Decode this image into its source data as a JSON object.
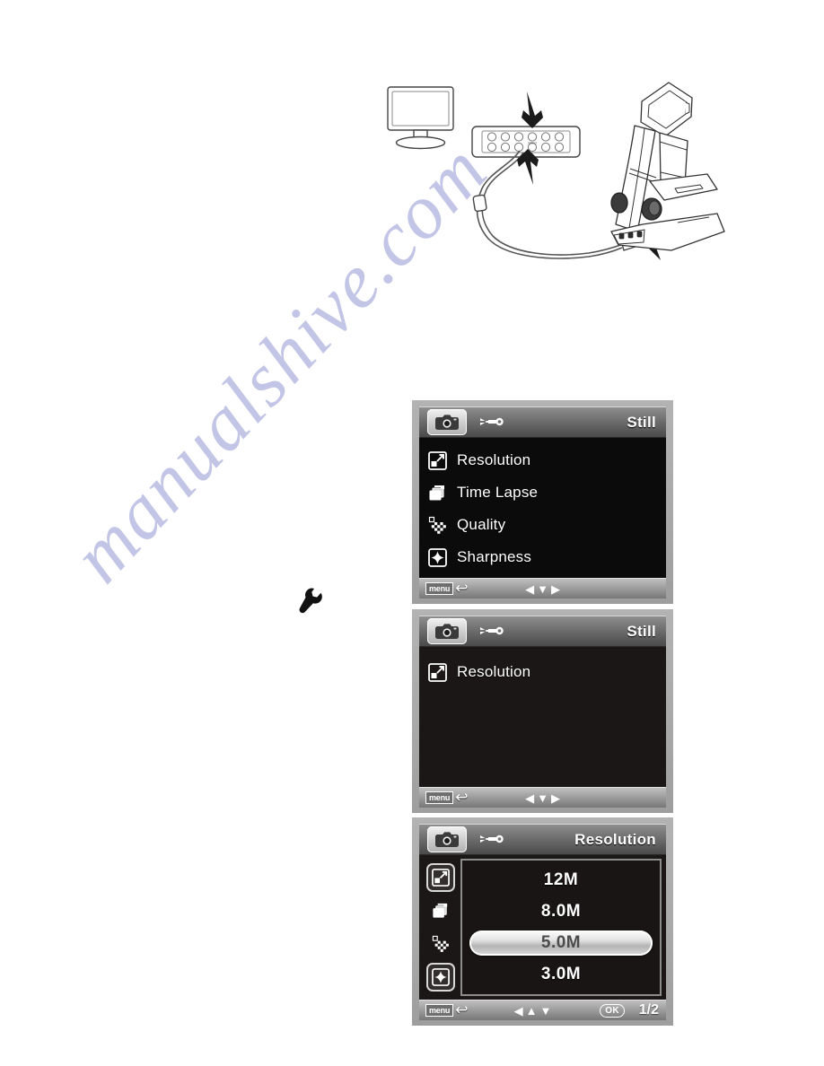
{
  "watermark": {
    "text": "manualshive.com"
  },
  "diagram": {
    "name": "tv-connection-diagram",
    "parts": [
      {
        "name": "monitor",
        "label": ""
      },
      {
        "name": "av-input-panel",
        "label": ""
      },
      {
        "name": "av-cable",
        "label": ""
      },
      {
        "name": "digital-microscope",
        "label": ""
      },
      {
        "name": "arrow-to-tv-port",
        "label": ""
      },
      {
        "name": "arrow-to-cable-plug",
        "label": ""
      },
      {
        "name": "arrow-to-microscope-port",
        "label": ""
      }
    ]
  },
  "body_wrench": {
    "icon": "wrench-icon"
  },
  "panels": [
    {
      "id": "osd-still-menu",
      "header": {
        "camera_tab": "camera-icon",
        "setup_tab": "wrench-icon",
        "mode_label": "Still"
      },
      "menu_items": [
        {
          "icon": "resolution-icon",
          "label": "Resolution"
        },
        {
          "icon": "time-lapse-icon",
          "label": "Time Lapse"
        },
        {
          "icon": "quality-icon",
          "label": "Quality"
        },
        {
          "icon": "sharpness-icon",
          "label": "Sharpness"
        }
      ],
      "footer": {
        "menu_label": "menu",
        "back_arrow": "↩",
        "dpad": [
          "◀",
          "▼",
          "▶"
        ],
        "ok_label": "",
        "page_label": ""
      }
    },
    {
      "id": "osd-still-resolution-only",
      "header": {
        "camera_tab": "camera-icon",
        "setup_tab": "wrench-icon",
        "mode_label": "Still"
      },
      "menu_items": [
        {
          "icon": "resolution-icon",
          "label": "Resolution"
        }
      ],
      "footer": {
        "menu_label": "menu",
        "back_arrow": "↩",
        "dpad": [
          "◀",
          "▼",
          "▶"
        ],
        "ok_label": "",
        "page_label": ""
      }
    },
    {
      "id": "osd-resolution-options",
      "header": {
        "camera_tab": "camera-icon",
        "setup_tab": "wrench-icon",
        "mode_label": "Resolution"
      },
      "side_rail": [
        {
          "icon": "resolution-icon",
          "selected": true
        },
        {
          "icon": "time-lapse-icon",
          "selected": false
        },
        {
          "icon": "quality-icon",
          "selected": false
        },
        {
          "icon": "sharpness-icon",
          "selected": false
        }
      ],
      "options": [
        {
          "label": "12M",
          "selected": false
        },
        {
          "label": "8.0M",
          "selected": false
        },
        {
          "label": "5.0M",
          "selected": true
        },
        {
          "label": "3.0M",
          "selected": false
        }
      ],
      "footer": {
        "menu_label": "menu",
        "back_arrow": "↩",
        "dpad": [
          "◀",
          "▲",
          "▼"
        ],
        "ok_label": "OK",
        "page_label": "1/2"
      }
    }
  ],
  "colors": {
    "panel_frame": "#a9a9a9",
    "screen_bg": "#0b0b0b",
    "header_grad_top": "#8e8e8e",
    "header_grad_bottom": "#4a4a4a",
    "text_white": "#ffffff",
    "selected_text": "#4b4b4b",
    "watermark": "#b9bce2"
  }
}
